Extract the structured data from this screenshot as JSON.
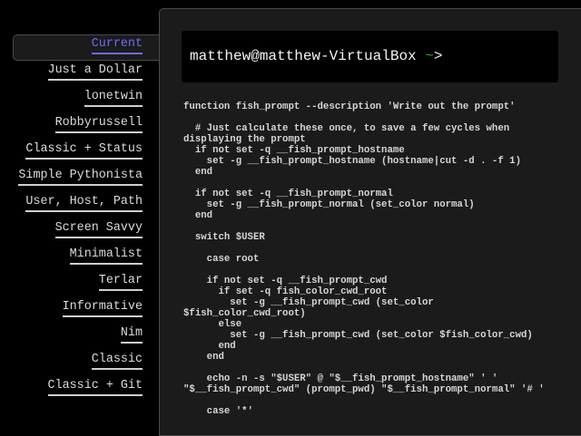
{
  "sidebar": {
    "items": [
      {
        "label": "Current",
        "selected": true
      },
      {
        "label": "Just a Dollar"
      },
      {
        "label": "lonetwin"
      },
      {
        "label": "Robbyrussell"
      },
      {
        "label": "Classic + Status"
      },
      {
        "label": "Simple Pythonista"
      },
      {
        "label": "User, Host, Path"
      },
      {
        "label": "Screen Savvy"
      },
      {
        "label": "Minimalist"
      },
      {
        "label": "Terlar"
      },
      {
        "label": "Informative"
      },
      {
        "label": "Nim"
      },
      {
        "label": "Classic"
      },
      {
        "label": "Classic + Git"
      }
    ]
  },
  "preview": {
    "user_host": "matthew@matthew-VirtualBox ",
    "cwd": "~",
    "suffix": ">"
  },
  "colors": {
    "accent": "#6b6bff",
    "tilde": "#2fa52f"
  },
  "code_lines": [
    "function fish_prompt --description 'Write out the prompt'",
    "",
    "  # Just calculate these once, to save a few cycles when",
    "displaying the prompt",
    "  if not set -q __fish_prompt_hostname",
    "    set -g __fish_prompt_hostname (hostname|cut -d . -f 1)",
    "  end",
    "",
    "  if not set -q __fish_prompt_normal",
    "    set -g __fish_prompt_normal (set_color normal)",
    "  end",
    "",
    "  switch $USER",
    "",
    "    case root",
    "",
    "    if not set -q __fish_prompt_cwd",
    "      if set -q fish_color_cwd_root",
    "        set -g __fish_prompt_cwd (set_color",
    "$fish_color_cwd_root)",
    "      else",
    "        set -g __fish_prompt_cwd (set_color $fish_color_cwd)",
    "      end",
    "    end",
    "",
    "    echo -n -s \"$USER\" @ \"$__fish_prompt_hostname\" ' '",
    "\"$__fish_prompt_cwd\" (prompt_pwd) \"$__fish_prompt_normal\" '# '",
    "",
    "    case '*'"
  ]
}
